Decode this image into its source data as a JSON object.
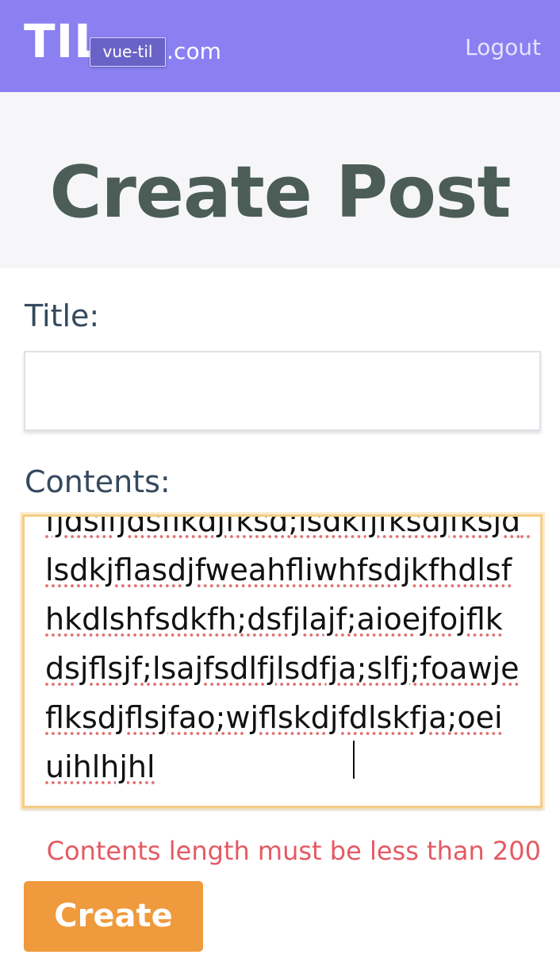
{
  "header": {
    "logo": "TIL",
    "logo_domain": "a.com",
    "tooltip": "vue-til",
    "logout_label": "Logout"
  },
  "page": {
    "title": "Create Post"
  },
  "form": {
    "title_label": "Title:",
    "title_value": "",
    "contents_label": "Contents:",
    "contents_value": "fjdslfjdsflkdjfksd;lsdkfjfksdjfksjd lsdkjflasdjfweahfliwhfsdjkfhdlsfhkdlshfsdkfh;dsfjlajf;aioejfojflkdsjflsjf;lsajfsdlfjlsdfja;slfj;foawjeflksdjflsjfao;wjflskdjfdlskfja;oeiuihlhjhl",
    "error_message": "Contents length must be less than 200",
    "submit_label": "Create"
  },
  "colors": {
    "header_bg": "#8a80f2",
    "title_color": "#4b5d56",
    "button_bg": "#ef9a3c",
    "error": "#e45a63",
    "focus_border": "#f5cd84"
  }
}
